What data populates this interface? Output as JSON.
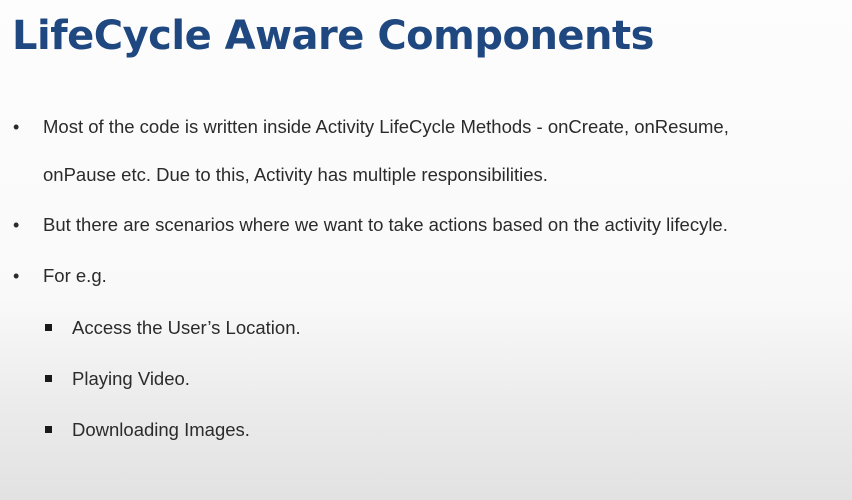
{
  "title": "LifeCycle Aware Components",
  "bullets": [
    {
      "lines": [
        "Most of the code is written inside Activity LifeCycle Methods - onCreate, onResume,",
        "onPause etc. Due to this, Activity has multiple responsibilities."
      ]
    },
    {
      "lines": [
        "But there are scenarios where we want to take actions based on the activity lifecyle."
      ]
    },
    {
      "lines": [
        "For e.g."
      ]
    }
  ],
  "sub_bullets": [
    "Access the User’s Location.",
    "Playing Video.",
    "Downloading Images."
  ]
}
